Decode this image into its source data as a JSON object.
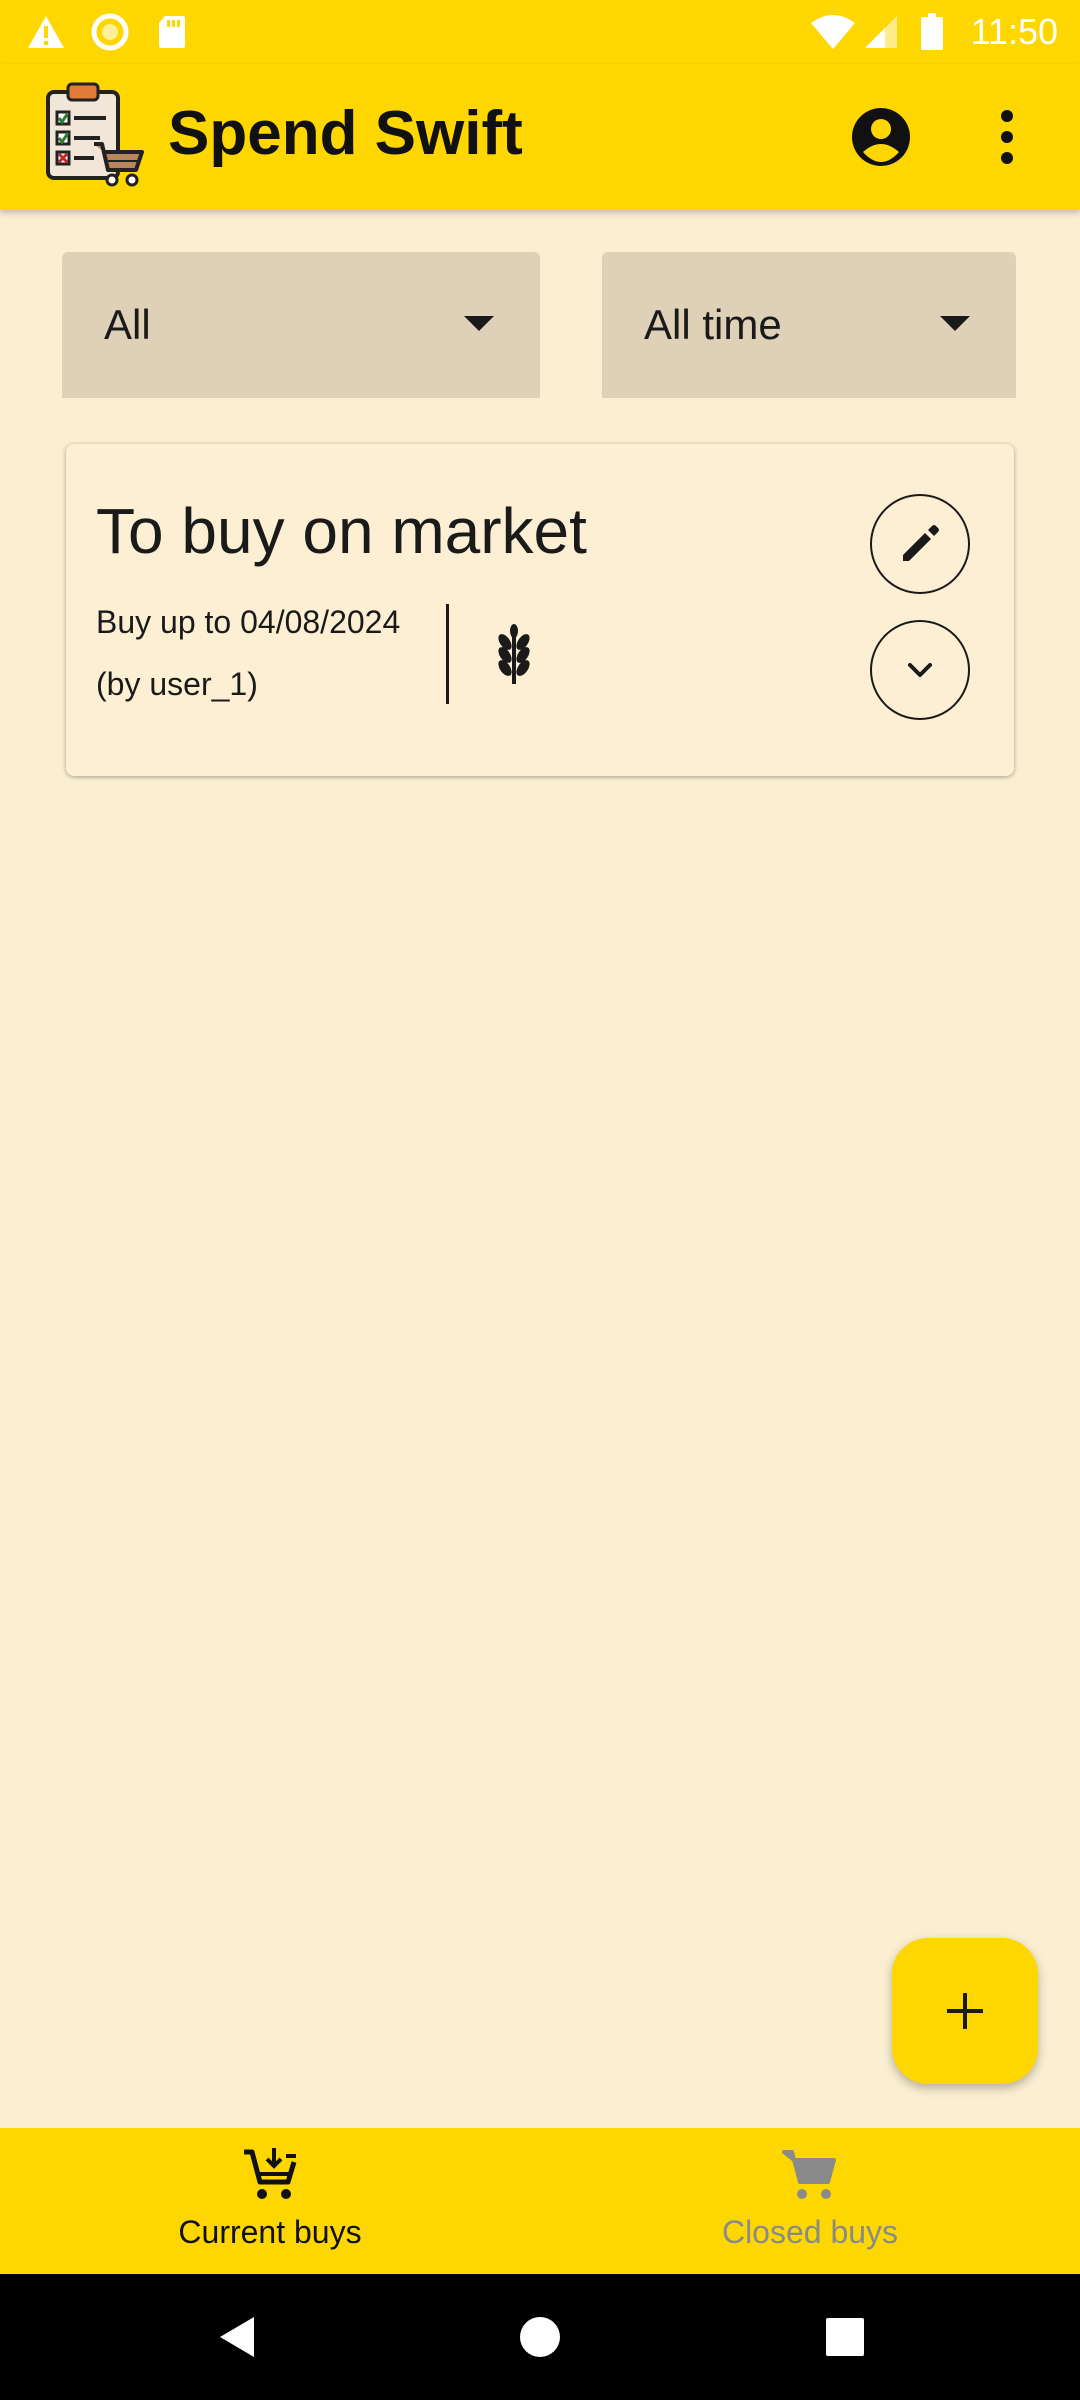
{
  "status_bar": {
    "time": "11:50",
    "left_icons": [
      "warning-icon",
      "sync-icon",
      "sd-card-icon"
    ],
    "right_icons": [
      "wifi-icon",
      "cellular-signal-icon",
      "battery-icon"
    ]
  },
  "app_bar": {
    "title": "Spend Swift",
    "logo_icon": "clipboard-cart-logo",
    "actions": [
      "account-circle-icon",
      "more-vert-icon"
    ]
  },
  "filters": {
    "category": {
      "selected": "All"
    },
    "period": {
      "selected": "All time"
    }
  },
  "buy_list": [
    {
      "title": "To buy on market",
      "date_text": "Buy up to 04/08/2024",
      "author_text": "(by user_1)",
      "category_icon": "wheat-icon"
    }
  ],
  "fab": {
    "icon": "plus-icon"
  },
  "bottom_nav": {
    "items": [
      {
        "label": "Current buys",
        "icon": "add-shopping-cart-icon",
        "active": true
      },
      {
        "label": "Closed buys",
        "icon": "shopping-cart-icon",
        "active": false
      }
    ]
  },
  "colors": {
    "primary": "#FFD700",
    "background": "#FBEFD2",
    "filter_bg": "#DFD0B8",
    "inactive_nav": "#8A8A8A"
  }
}
